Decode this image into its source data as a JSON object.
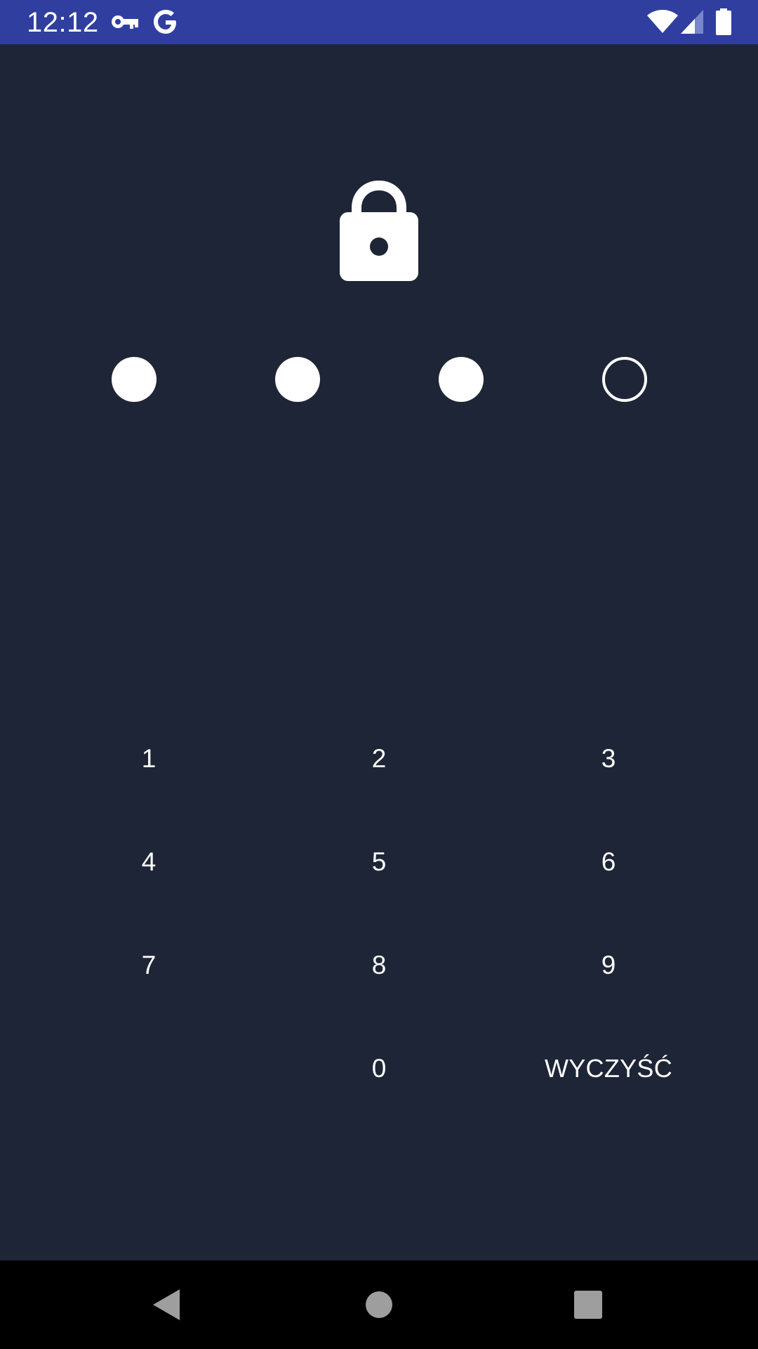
{
  "status_bar": {
    "time": "12:12",
    "icons": [
      "key-icon",
      "google-g-icon",
      "wifi-icon",
      "signal-icon",
      "battery-icon"
    ],
    "background": "#303f9f"
  },
  "lock": {
    "icon": "lock-icon"
  },
  "pin": {
    "length": 4,
    "entered": 3
  },
  "keypad": {
    "keys": [
      "1",
      "2",
      "3",
      "4",
      "5",
      "6",
      "7",
      "8",
      "9",
      "0"
    ],
    "clear_label": "WYCZYŚĆ"
  },
  "nav_bar": {
    "buttons": [
      "back-icon",
      "home-icon",
      "recents-icon"
    ]
  },
  "colors": {
    "background": "#1e2536",
    "foreground": "#ffffff",
    "nav_button": "#9e9e9e"
  }
}
